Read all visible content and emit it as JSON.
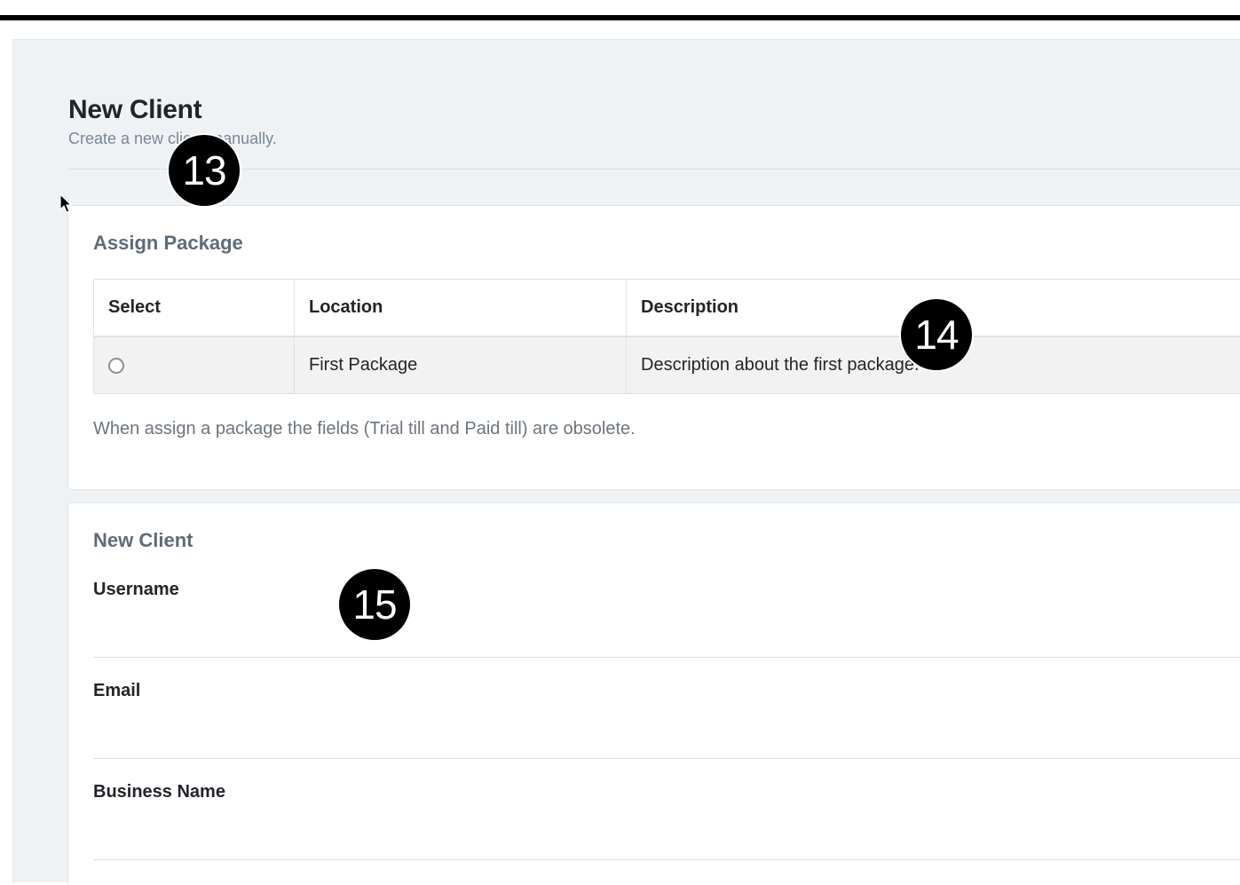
{
  "header": {
    "title": "New Client",
    "subtitle": "Create a new client manually."
  },
  "assign_package": {
    "title": "Assign Package",
    "columns": [
      "Select",
      "Location",
      "Description"
    ],
    "rows": [
      {
        "location": "First Package",
        "description": "Description about the first package."
      }
    ],
    "note": "When assign a package the fields (Trial till and Paid till) are obsolete."
  },
  "new_client": {
    "title": "New Client",
    "fields": [
      {
        "label": "Username",
        "value": ""
      },
      {
        "label": "Email",
        "value": ""
      },
      {
        "label": "Business Name",
        "value": ""
      }
    ]
  },
  "markers": [
    "13",
    "14",
    "15"
  ]
}
